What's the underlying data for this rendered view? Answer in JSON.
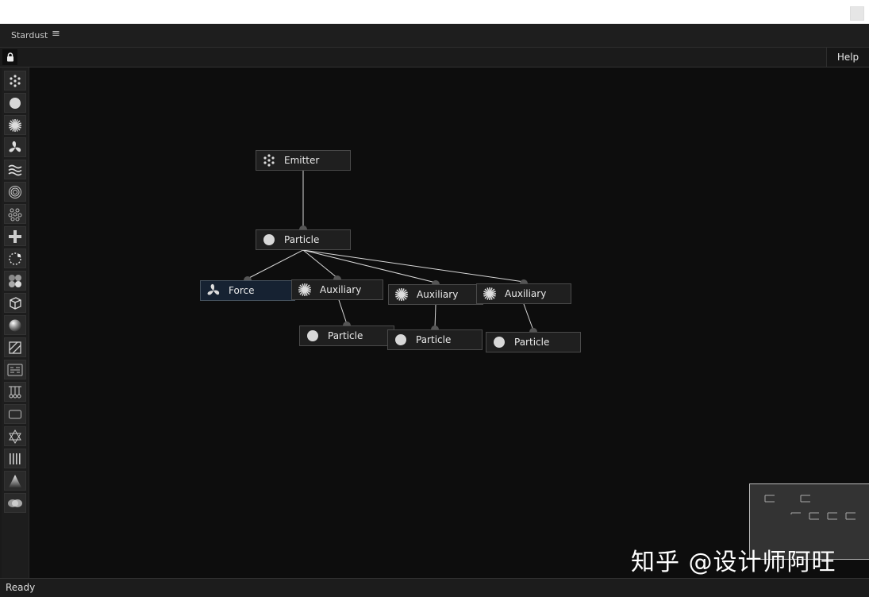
{
  "app": {
    "title": "Stardust",
    "menu_icon": "hamburger-icon"
  },
  "toolbar": {
    "lock_icon": "lock-icon",
    "help_label": "Help"
  },
  "sidebar": {
    "tools": [
      {
        "name": "emitter",
        "icon": "emitter-dots-icon"
      },
      {
        "name": "particle",
        "icon": "circle-icon"
      },
      {
        "name": "auxiliary",
        "icon": "burst-icon"
      },
      {
        "name": "force",
        "icon": "fan-icon"
      },
      {
        "name": "turbulence",
        "icon": "waves-icon"
      },
      {
        "name": "vortex",
        "icon": "rings-icon"
      },
      {
        "name": "group",
        "icon": "cluster-icon"
      },
      {
        "name": "add",
        "icon": "plus-icon"
      },
      {
        "name": "circle-path",
        "icon": "dashed-circle-icon"
      },
      {
        "name": "colors",
        "icon": "four-circles-icon"
      },
      {
        "name": "model",
        "icon": "cube-icon"
      },
      {
        "name": "sphere",
        "icon": "sphere-icon"
      },
      {
        "name": "mask",
        "icon": "hatched-square-icon"
      },
      {
        "name": "text",
        "icon": "text-grid-icon"
      },
      {
        "name": "spring",
        "icon": "pendulum-icon"
      },
      {
        "name": "shape",
        "icon": "rounded-rect-icon"
      },
      {
        "name": "atom",
        "icon": "atom-icon"
      },
      {
        "name": "lines",
        "icon": "bars-icon"
      },
      {
        "name": "light",
        "icon": "light-cone-icon"
      },
      {
        "name": "merge",
        "icon": "blob-icon"
      }
    ]
  },
  "graph": {
    "nodes": [
      {
        "id": "emitter",
        "label": "Emitter",
        "icon": "emitter-dots-icon"
      },
      {
        "id": "particle1",
        "label": "Particle",
        "icon": "circle-icon"
      },
      {
        "id": "force",
        "label": "Force",
        "icon": "fan-icon",
        "selected": true
      },
      {
        "id": "aux1",
        "label": "Auxiliary",
        "icon": "burst-icon"
      },
      {
        "id": "aux2",
        "label": "Auxiliary",
        "icon": "burst-icon"
      },
      {
        "id": "aux3",
        "label": "Auxiliary",
        "icon": "burst-icon"
      },
      {
        "id": "particle2",
        "label": "Particle",
        "icon": "circle-icon"
      },
      {
        "id": "particle3",
        "label": "Particle",
        "icon": "circle-icon"
      },
      {
        "id": "particle4",
        "label": "Particle",
        "icon": "circle-icon"
      }
    ],
    "links": [
      [
        "emitter",
        "particle1"
      ],
      [
        "particle1",
        "force"
      ],
      [
        "particle1",
        "aux1"
      ],
      [
        "particle1",
        "aux2"
      ],
      [
        "particle1",
        "aux3"
      ],
      [
        "aux1",
        "particle2"
      ],
      [
        "aux2",
        "particle3"
      ],
      [
        "aux3",
        "particle4"
      ]
    ]
  },
  "status": {
    "text": "Ready"
  },
  "watermark": "知乎 @设计师阿旺"
}
